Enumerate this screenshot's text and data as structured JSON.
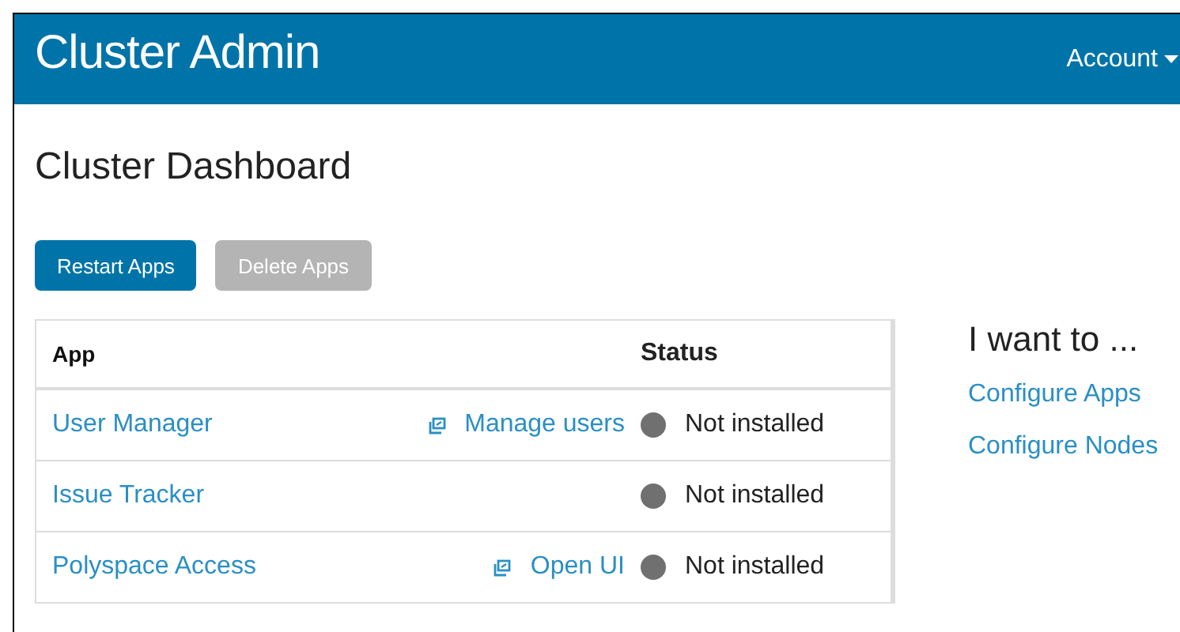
{
  "header": {
    "title": "Cluster Admin",
    "account_menu": "Account"
  },
  "page_title": "Cluster Dashboard",
  "buttons": [
    {
      "label": "Restart Apps",
      "disabled": false
    },
    {
      "label": "Delete Apps",
      "disabled": true
    }
  ],
  "table": {
    "columns": [
      "App",
      "Status"
    ],
    "rows": [
      {
        "app": "User Manager",
        "action": "Manage users",
        "status": "Not installed"
      },
      {
        "app": "Issue Tracker",
        "status": "Not installed"
      },
      {
        "app": "Polyspace Access",
        "action": "Open UI",
        "status": "Not installed"
      }
    ]
  },
  "side": {
    "title": "I want to ...",
    "links": [
      "Configure Apps",
      "Configure Nodes"
    ]
  }
}
